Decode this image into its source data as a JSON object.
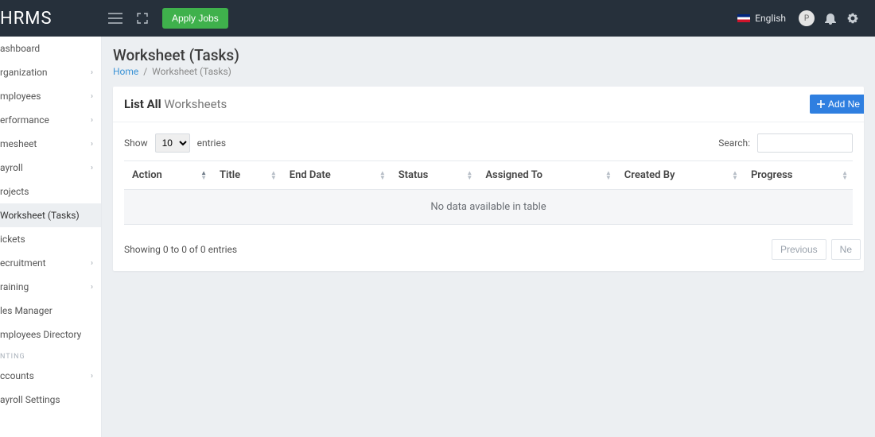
{
  "brand": "HRMS",
  "header": {
    "apply_jobs": "Apply Jobs",
    "language": "English",
    "avatar_initial": "P"
  },
  "sidebar": {
    "items": [
      {
        "label": "ashboard",
        "chev": false,
        "active": false
      },
      {
        "label": "rganization",
        "chev": true,
        "active": false
      },
      {
        "label": "mployees",
        "chev": true,
        "active": false
      },
      {
        "label": "erformance",
        "chev": true,
        "active": false
      },
      {
        "label": "mesheet",
        "chev": true,
        "active": false
      },
      {
        "label": "ayroll",
        "chev": true,
        "active": false
      },
      {
        "label": "rojects",
        "chev": false,
        "active": false
      },
      {
        "label": "Worksheet (Tasks)",
        "chev": false,
        "active": true
      },
      {
        "label": "ickets",
        "chev": false,
        "active": false
      },
      {
        "label": "ecruitment",
        "chev": true,
        "active": false
      },
      {
        "label": "raining",
        "chev": true,
        "active": false
      },
      {
        "label": "les Manager",
        "chev": false,
        "active": false
      },
      {
        "label": "mployees Directory",
        "chev": false,
        "active": false
      }
    ],
    "section_label": "NTING",
    "section_items": [
      {
        "label": "ccounts",
        "chev": true,
        "active": false
      },
      {
        "label": "ayroll Settings",
        "chev": false,
        "active": false
      }
    ]
  },
  "page": {
    "title": "Worksheet (Tasks)",
    "breadcrumb_home": "Home",
    "breadcrumb_sep": "/",
    "breadcrumb_current": "Worksheet (Tasks)"
  },
  "card": {
    "title_bold": "List All",
    "title_muted": "Worksheets",
    "add_new_label": "Add Ne"
  },
  "datatable": {
    "show_label": "Show",
    "entries_label": "entries",
    "length_value": "10",
    "search_label": "Search:",
    "search_value": "",
    "columns": [
      "Action",
      "Title",
      "End Date",
      "Status",
      "Assigned To",
      "Created By",
      "Progress"
    ],
    "empty_text": "No data available in table",
    "info_text": "Showing 0 to 0 of 0 entries",
    "prev_label": "Previous",
    "next_label": "Ne"
  }
}
